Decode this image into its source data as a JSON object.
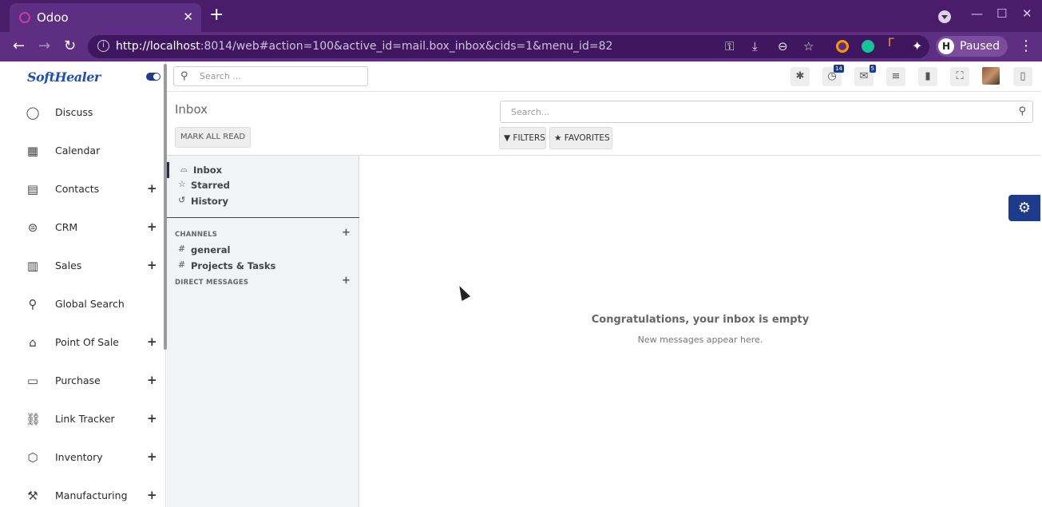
{
  "browser": {
    "tab_title": "Odoo",
    "tab_close": "✕",
    "new_tab": "+",
    "url_host": "http://localhost",
    "url_rest": ":8014/web#action=100&active_id=mail.box_inbox&cids=1&menu_id=82",
    "profile_label": "Paused",
    "profile_initial": "H"
  },
  "app": {
    "logo": "SoftHealer",
    "search_placeholder": "Search ...",
    "badges": {
      "activities": "14",
      "messages": "5"
    }
  },
  "sidebar": {
    "items": [
      {
        "label": "Discuss",
        "icon": "chat-icon",
        "expandable": false
      },
      {
        "label": "Calendar",
        "icon": "calendar-icon",
        "expandable": false
      },
      {
        "label": "Contacts",
        "icon": "address-card-icon",
        "expandable": true
      },
      {
        "label": "CRM",
        "icon": "crm-icon",
        "expandable": true
      },
      {
        "label": "Sales",
        "icon": "bar-chart-icon",
        "expandable": true
      },
      {
        "label": "Global Search",
        "icon": "search-icon",
        "expandable": false
      },
      {
        "label": "Point Of Sale",
        "icon": "store-icon",
        "expandable": true
      },
      {
        "label": "Purchase",
        "icon": "credit-card-icon",
        "expandable": true
      },
      {
        "label": "Link Tracker",
        "icon": "link-icon",
        "expandable": true
      },
      {
        "label": "Inventory",
        "icon": "box-icon",
        "expandable": true
      },
      {
        "label": "Manufacturing",
        "icon": "wrench-icon",
        "expandable": true
      }
    ]
  },
  "control": {
    "breadcrumb": "Inbox",
    "mark_all_read": "MARK ALL READ",
    "search_placeholder": "Search...",
    "filters": "FILTERS",
    "favorites": "FAVORITES"
  },
  "discuss": {
    "mailboxes": [
      "Inbox",
      "Starred",
      "History"
    ],
    "channels_header": "CHANNELS",
    "channels": [
      "general",
      "Projects & Tasks"
    ],
    "dm_header": "DIRECT MESSAGES",
    "empty_title": "Congratulations, your inbox is empty",
    "empty_sub": "New messages appear here."
  },
  "colors": {
    "browser_frame": "#4a1d6b",
    "accent": "#1e3a8a",
    "panel_bg": "#f2f3f4"
  }
}
